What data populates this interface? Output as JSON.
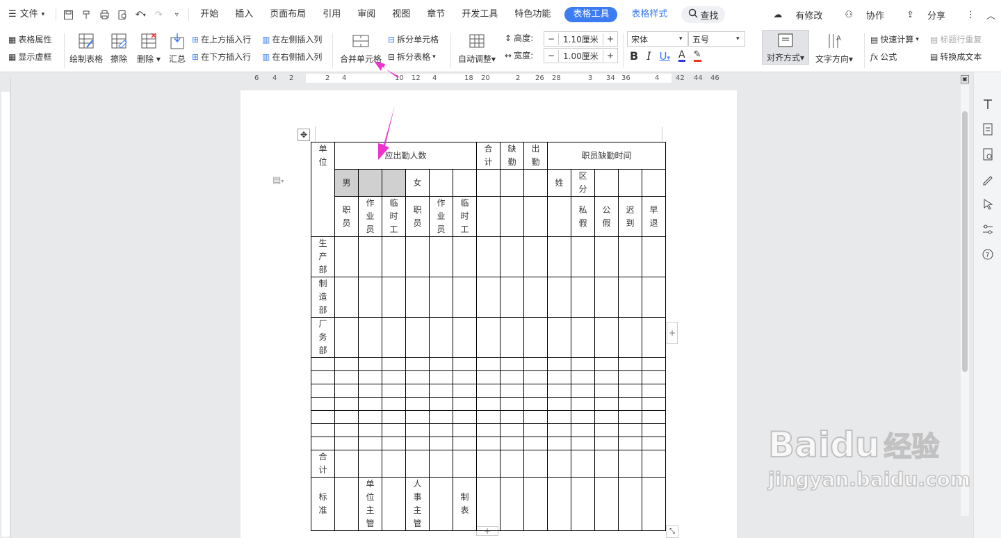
{
  "menubar": {
    "file": "文件",
    "tabs": [
      "开始",
      "插入",
      "页面布局",
      "引用",
      "审阅",
      "视图",
      "章节",
      "开发工具",
      "特色功能"
    ],
    "active_tab": "表格工具",
    "tab2": "表格样式",
    "search": "查找",
    "modified": "有修改",
    "collab": "协作",
    "share": "分享"
  },
  "ribbon": {
    "table_props": "表格属性",
    "show_grid": "显示虚框",
    "draw_table": "绘制表格",
    "erase": "擦除",
    "delete": "删除",
    "summary": "汇总",
    "insert_above": "在上方插入行",
    "insert_below": "在下方插入行",
    "insert_left": "在左侧插入列",
    "insert_right": "在右侧插入列",
    "merge_cells": "合并单元格",
    "split_cells": "拆分单元格",
    "split_table": "拆分表格",
    "auto_fit": "自动调整",
    "height_label": "高度:",
    "height_value": "1.10厘米",
    "width_label": "宽度:",
    "width_value": "1.00厘米",
    "font_name": "宋体",
    "font_size": "五号",
    "align": "对齐方式",
    "text_dir": "文字方向",
    "quick_calc": "快速计算",
    "repeat_header": "标题行重复",
    "formula": "公式",
    "to_text": "转换成文本"
  },
  "ruler": [
    "6",
    "4",
    "2",
    "2",
    "4",
    "10",
    "12",
    "4",
    "18",
    "20",
    "2",
    "26",
    "28",
    "3",
    "34",
    "36",
    "4",
    "42",
    "44",
    "46"
  ],
  "table": {
    "h_unit": "单位",
    "h_should": "应出勤人数",
    "h_total": "合计",
    "h_absent": "缺勤",
    "h_attend": "出勤",
    "h_absent_time": "职员缺勤时间",
    "male": "男",
    "female": "女",
    "name": "姓",
    "category": "区分",
    "staff1": "职员",
    "worker1": "作业员",
    "temp1": "临时工",
    "staff2": "职员",
    "worker2": "作业员",
    "temp2": "临时工",
    "private_leave": "私假",
    "public_leave": "公假",
    "late": "迟到",
    "early": "早退",
    "prod": "生产部",
    "mfg": "制造部",
    "factory": "厂务部",
    "sum": "合计",
    "std": "标准",
    "unit_mgr": "单位主管",
    "hr_mgr": "人事主管",
    "made_by": "制表"
  },
  "watermark": {
    "brand": "Baidu",
    "cn": "经验",
    "url": "jingyan.baidu.com"
  },
  "colors": {
    "accent": "#3c7cf0",
    "arrow": "#ee33cc",
    "gray_cell": "#d0d0d0"
  }
}
